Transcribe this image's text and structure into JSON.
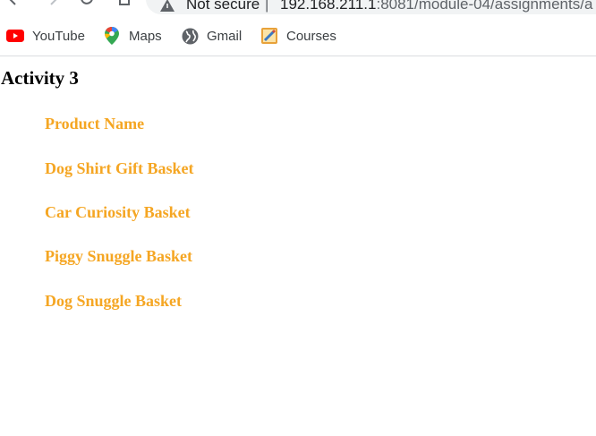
{
  "browser": {
    "security_label": "Not secure",
    "separator": "|",
    "url_host": "192.168.211.1",
    "url_rest": ":8081/module-04/assignments/a",
    "icons": [
      "back-arrow-icon",
      "forward-arrow-icon",
      "reload-icon",
      "home-icon",
      "warning-triangle-icon"
    ]
  },
  "bookmarks": [
    {
      "label": "YouTube",
      "icon": "youtube-icon"
    },
    {
      "label": "Maps",
      "icon": "maps-pin-icon"
    },
    {
      "label": "Gmail",
      "icon": "globe-icon"
    },
    {
      "label": "Courses",
      "icon": "notepad-icon"
    }
  ],
  "page": {
    "title": "Activity 3",
    "accent_color": "#f5a623",
    "products": [
      "Product Name",
      "Dog Shirt Gift Basket",
      "Car Curiosity Basket",
      "Piggy Snuggle Basket",
      "Dog Snuggle Basket"
    ]
  }
}
